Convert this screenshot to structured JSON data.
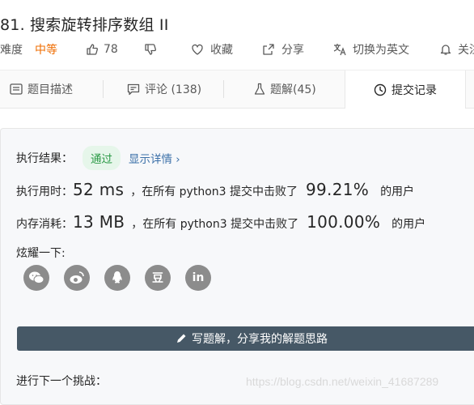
{
  "problem": {
    "title": "81. 搜索旋转排序数组 II"
  },
  "meta": {
    "difficulty_label": "难度",
    "difficulty_value": "中等",
    "likes": "78",
    "favorite_label": "收藏",
    "share_label": "分享",
    "switch_lang_label": "切换为英文",
    "notify_label": "关注"
  },
  "tabs": [
    {
      "label": "题目描述",
      "icon": "description-icon"
    },
    {
      "label": "评论 (138)",
      "icon": "comment-icon"
    },
    {
      "label": "题解(45)",
      "icon": "flask-icon"
    },
    {
      "label": "提交记录",
      "icon": "clock-icon"
    }
  ],
  "result": {
    "label": "执行结果：",
    "status": "通过",
    "details_link": "显示详情 ›",
    "runtime_label": "执行用时：",
    "runtime_value": "52 ms",
    "runtime_text": "，在所有 python3 提交中击败了",
    "runtime_percent": "99.21%",
    "runtime_suffix": "的用户",
    "memory_label": "内存消耗：",
    "memory_value": "13 MB",
    "memory_text": "，在所有 python3 提交中击败了",
    "memory_percent": "100.00%",
    "memory_suffix": "的用户",
    "share_label": "炫耀一下:"
  },
  "share_targets": [
    "wechat-icon",
    "weibo-icon",
    "qq-icon",
    "douban-icon",
    "linkedin-icon"
  ],
  "douban_glyph": "豆",
  "linkedin_glyph": "in",
  "write_button": "写题解，分享我的解题思路",
  "next_challenge": "进行下一个挑战：",
  "watermark": "https://blog.csdn.net/weixin_41687289",
  "colors": {
    "difficulty": "#ef6c00",
    "pass_badge_bg": "#e6f6ea",
    "pass_badge_text": "#2b9a46",
    "button_bg": "#465866",
    "icon_gray": "#8c8c8c"
  }
}
